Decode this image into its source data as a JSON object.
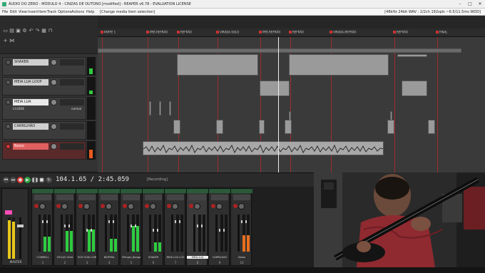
{
  "titlebar": {
    "title": "ÁUDIO DO ZERO - MÓDULO 4 - CINZAS DE OUTONO [modified] - REAPER v6.78 - EVALUATION LICENSE",
    "min": "–",
    "max": "□",
    "close": "✕"
  },
  "menubar": {
    "items": [
      "File",
      "Edit",
      "View",
      "Insert",
      "Item",
      "Track",
      "Options",
      "Actions",
      "Help"
    ],
    "status": "[Change media item selection]",
    "right": "[48kHz 24bit WAV : 2/2ch 192spls ~6.5/11.5ms WDD]"
  },
  "markers": [
    {
      "label": "PARTE 1"
    },
    {
      "label": "PRÉ-REFRÃO"
    },
    {
      "label": "REFRÃO"
    },
    {
      "label": "VIRADA-SOLO"
    },
    {
      "label": "PRÉ-REFRÃO"
    },
    {
      "label": "REFRÃO"
    },
    {
      "label": "VIRADA-REFRÃO"
    },
    {
      "label": "REFRÃO"
    },
    {
      "label": "FINAL"
    }
  ],
  "tracks": [
    {
      "name": "SHAKER",
      "sub": ""
    },
    {
      "name": "MEIA LUA LOOP",
      "sub": ""
    },
    {
      "name": "MEIA LUA",
      "sub": "LS:DIDE",
      "sub2": "normal"
    },
    {
      "name": "CARRILHÃO",
      "sub": ""
    },
    {
      "name": "Baixo",
      "sub": ""
    }
  ],
  "transport": {
    "time": "104.1.65 / 2:45.059",
    "status": "[Recording]"
  },
  "mixer": {
    "master_label": "MASTER",
    "strips": [
      {
        "name": "COWBELL",
        "num": "1",
        "level": 0.4
      },
      {
        "name": "VIOLÃO GUIA",
        "num": "2",
        "level": 0.55
      },
      {
        "name": "VOZ GUIA LOW",
        "num": "3",
        "level": 0.6
      },
      {
        "name": "BATERIA",
        "num": "4",
        "level": 0.35
      },
      {
        "name": "OFinger_Bongo",
        "num": "5",
        "level": 0.7
      },
      {
        "name": "SHAKER",
        "num": "6",
        "level": 0.25
      },
      {
        "name": "MEIA LUA LOO",
        "num": "7",
        "level": 0.0
      },
      {
        "name": "MEIA LUA",
        "num": "8",
        "level": 0.0
      },
      {
        "name": "CARRILHÃO",
        "num": "9",
        "level": 0.0
      },
      {
        "name": "Baixo",
        "num": "10",
        "level": 0.45
      }
    ]
  },
  "colors": {
    "accent": "#2ecc40",
    "record": "#d33333",
    "marker": "#cc3333"
  }
}
